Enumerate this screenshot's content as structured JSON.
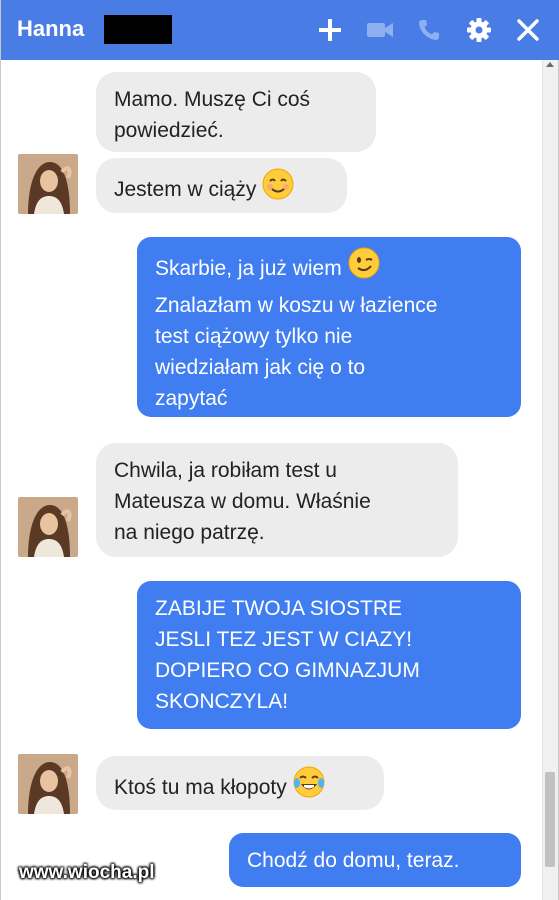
{
  "header": {
    "contact_name": "Hanna",
    "icons": [
      "plus-icon",
      "video-camera-icon",
      "phone-icon",
      "gear-icon",
      "close-icon"
    ]
  },
  "messages": [
    {
      "from": "contact",
      "lines": [
        "Mamo. Muszę Ci coś",
        "powiedzieć."
      ]
    },
    {
      "from": "contact",
      "lines": [
        "Jestem w ciąży"
      ],
      "emoji": "smiling-face-icon"
    },
    {
      "from": "me",
      "lines": [
        "Skarbie, ja już wiem",
        "Znalazłam w koszu w łazience",
        "test ciążowy tylko nie",
        "wiedziałam jak cię o to",
        "zapytać"
      ],
      "emoji": "winking-face-icon"
    },
    {
      "from": "contact",
      "lines": [
        "Chwila, ja robiłam test u",
        "Mateusza w domu. Właśnie",
        "na niego patrzę."
      ]
    },
    {
      "from": "me",
      "lines": [
        "ZABIJE TWOJA SIOSTRE",
        "JESLI TEZ JEST W CIAZY!",
        "DOPIERO CO GIMNAZJUM",
        "SKONCZYLA!"
      ]
    },
    {
      "from": "contact",
      "lines": [
        "Ktoś tu ma kłopoty"
      ],
      "emoji": "tears-of-joy-icon"
    },
    {
      "from": "me",
      "lines": [
        "Chodź do domu, teraz."
      ]
    }
  ],
  "watermark": "www.wiocha.pl",
  "colors": {
    "header": "#4a7ce6",
    "outgoing_bubble": "#3f7df0",
    "incoming_bubble": "#ececec"
  }
}
